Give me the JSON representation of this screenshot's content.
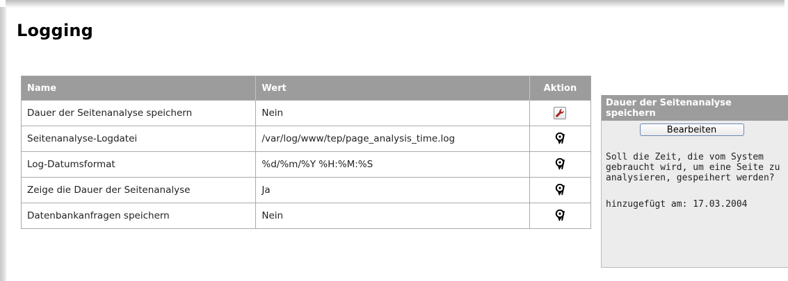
{
  "page": {
    "title": "Logging"
  },
  "table": {
    "headers": {
      "name": "Name",
      "wert": "Wert",
      "aktion": "Aktion"
    },
    "rows": [
      {
        "name": "Dauer der Seitenanalyse speichern",
        "value": "Nein",
        "action_icon": "edit-icon"
      },
      {
        "name": "Seitenanalyse-Logdatei",
        "value": "/var/log/www/tep/page_analysis_time.log",
        "action_icon": "info-icon"
      },
      {
        "name": "Log-Datumsformat",
        "value": "%d/%m/%Y %H:%M:%S",
        "action_icon": "info-icon"
      },
      {
        "name": "Zeige die Dauer der Seitenanalyse",
        "value": "Ja",
        "action_icon": "info-icon"
      },
      {
        "name": "Datenbankanfragen speichern",
        "value": "Nein",
        "action_icon": "info-icon"
      }
    ]
  },
  "side_panel": {
    "title": "Dauer der Seitenanalyse speichern",
    "button_label": "Bearbeiten",
    "description": "Soll die Zeit, die vom System gebraucht wird, um eine Seite zu analysieren, gespeihert werden?",
    "added_label": "hinzugefügt am: 17.03.2004"
  },
  "colors": {
    "header_bg": "#9c9c9c",
    "panel_bg": "#ececec",
    "edit_icon_red": "#c0221b",
    "button_border": "#6a88b4"
  }
}
